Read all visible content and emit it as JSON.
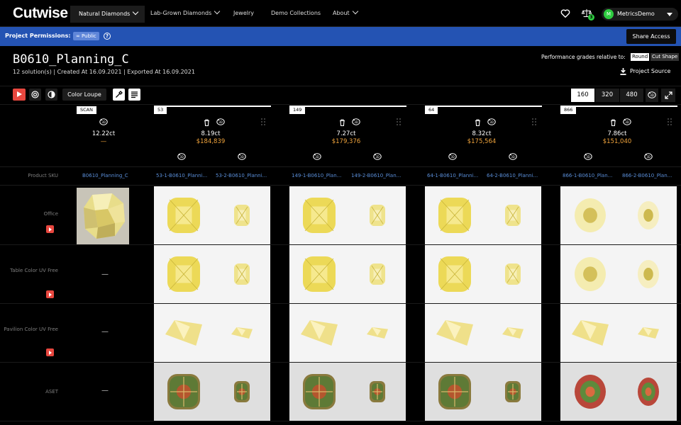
{
  "nav": {
    "logo": "Cutwise",
    "items": [
      "Natural Diamonds",
      "Lab-Grown Diamonds",
      "Jewelry",
      "Demo Collections",
      "About"
    ],
    "badge_count": "3",
    "user_initial": "M",
    "user_name": "MetricsDemo"
  },
  "permissions": {
    "label": "Project Permissions:",
    "badge": "∞ Public",
    "help": "?",
    "share": "Share Access"
  },
  "header": {
    "title": "B0610_Planning_C",
    "meta": "12 solution(s) | Created At 16.09.2021 | Exported At 16.09.2021",
    "perf_label": "Performance grades relative to:",
    "perf_round": "Round",
    "perf_cut": "Cut Shape",
    "project_source": "Project Source"
  },
  "toolbar": {
    "color_loupe": "Color Loupe",
    "zoom": [
      "160",
      "320",
      "480"
    ]
  },
  "rows": [
    "Product SKU",
    "Office",
    "Table Color UV Free",
    "Pavilion Color UV Free",
    "ASET"
  ],
  "scan": {
    "tag": "SCAN",
    "carat": "12.22ct",
    "price": "—",
    "sku": "B0610_Planning_C",
    "dash": "—"
  },
  "solutions": [
    {
      "tag": "53",
      "carat": "8.19ct",
      "price": "$184,839",
      "sku1": "53-1-B0610_Planni...",
      "sku2": "53-2-B0610_Planni..."
    },
    {
      "tag": "149",
      "carat": "7.27ct",
      "price": "$179,376",
      "sku1": "149-1-B0610_Plan...",
      "sku2": "149-2-B0610_Plan..."
    },
    {
      "tag": "64",
      "carat": "8.32ct",
      "price": "$175,564",
      "sku1": "64-1-B0610_Planni...",
      "sku2": "64-2-B0610_Planni..."
    },
    {
      "tag": "866",
      "carat": "7.86ct",
      "price": "$151,040",
      "sku1": "866-1-B0610_Plan...",
      "sku2": "866-2-B0610_Plan..."
    }
  ],
  "colors": {
    "accent_red": "#e8473f",
    "permission_blue": "#2453b3",
    "price_orange": "#f0a43c",
    "sku_link": "#5a8ed8",
    "online_green": "#2ecc40"
  },
  "icons": [
    "heart-icon",
    "compare-scale-icon",
    "help-icon",
    "download-icon",
    "play-icon",
    "aperture-icon",
    "contrast-icon",
    "eyedropper-icon",
    "text-align-icon",
    "view-3d-icon",
    "expand-icon",
    "trash-icon",
    "drag-handle-icon",
    "chevron-down-icon"
  ]
}
